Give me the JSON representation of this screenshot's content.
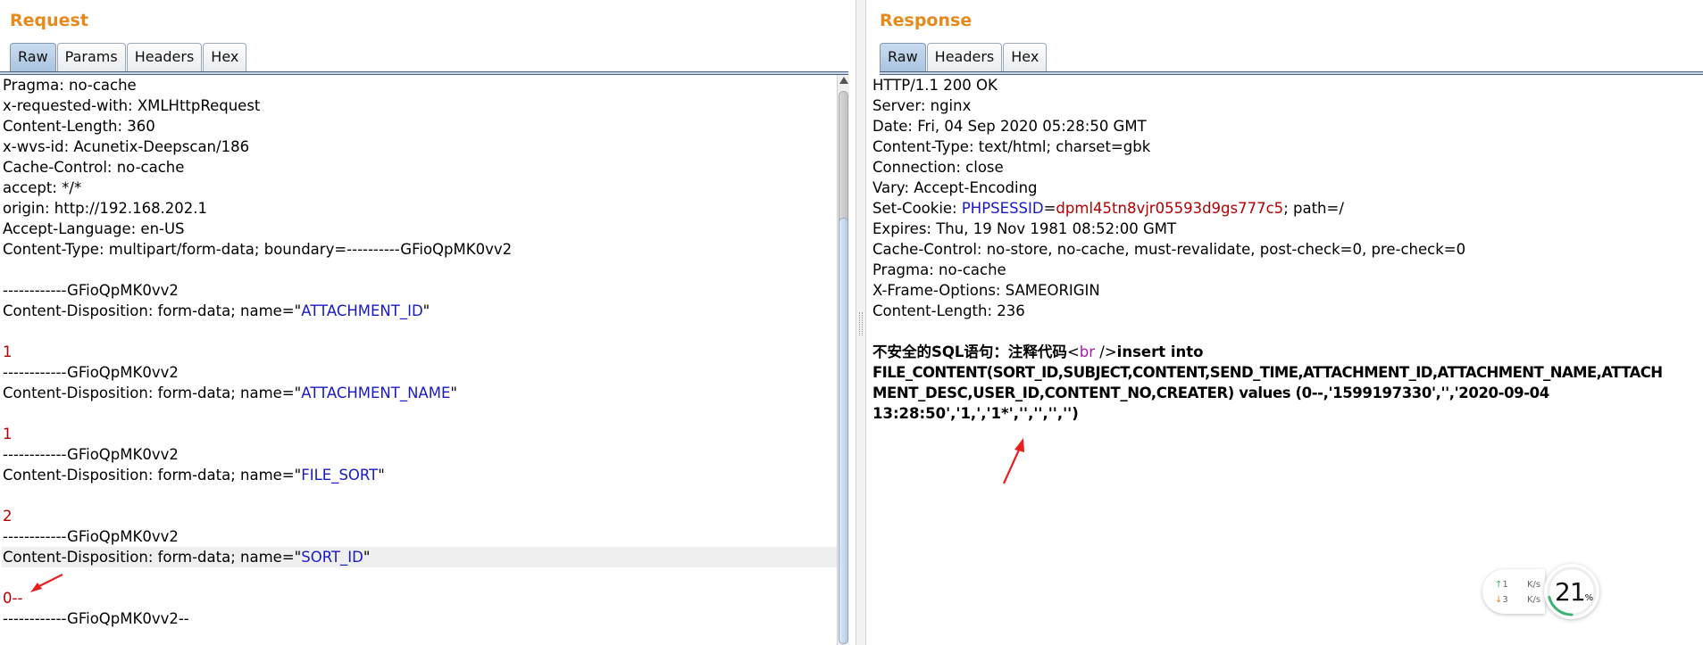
{
  "request": {
    "title": "Request",
    "tabs": [
      "Raw",
      "Params",
      "Headers",
      "Hex"
    ],
    "active_tab": "Raw",
    "lines": [
      "Pragma: no-cache",
      "x-requested-with: XMLHttpRequest",
      "Content-Length: 360",
      "x-wvs-id: Acunetix-Deepscan/186",
      "Cache-Control: no-cache",
      "accept: */*",
      "origin: http://192.168.202.1",
      "Accept-Language: en-US",
      "Content-Type: multipart/form-data; boundary=----------GFioQpMK0vv2",
      "",
      "------------GFioQpMK0vv2",
      "Content-Disposition: form-data; name=\"ATTACHMENT_ID\"",
      "",
      "1",
      "------------GFioQpMK0vv2",
      "Content-Disposition: form-data; name=\"ATTACHMENT_NAME\"",
      "",
      "1",
      "------------GFioQpMK0vv2",
      "Content-Disposition: form-data; name=\"FILE_SORT\"",
      "",
      "2",
      "------------GFioQpMK0vv2",
      "Content-Disposition: form-data; name=\"SORT_ID\"",
      "",
      "0--",
      "------------GFioQpMK0vv2--"
    ],
    "cd_prefix": "Content-Disposition: form-data; name=",
    "field_names": [
      "ATTACHMENT_ID",
      "ATTACHMENT_NAME",
      "FILE_SORT",
      "SORT_ID"
    ],
    "values": [
      "1",
      "1",
      "2",
      "0--"
    ]
  },
  "response": {
    "title": "Response",
    "tabs": [
      "Raw",
      "Headers",
      "Hex"
    ],
    "active_tab": "Raw",
    "headers": [
      "HTTP/1.1 200 OK",
      "Server: nginx",
      "Date: Fri, 04 Sep 2020 05:28:50 GMT",
      "Content-Type: text/html; charset=gbk",
      "Connection: close",
      "Vary: Accept-Encoding"
    ],
    "set_cookie": {
      "prefix": "Set-Cookie: ",
      "name": "PHPSESSID",
      "eq": "=",
      "value": "dpml45tn8vjr05593d9gs777c5",
      "suffix": "; path=/"
    },
    "headers2": [
      "Expires: Thu, 19 Nov 1981 08:52:00 GMT",
      "Cache-Control: no-store, no-cache, must-revalidate, post-check=0, pre-check=0",
      "Pragma: no-cache",
      "X-Frame-Options: SAMEORIGIN",
      "Content-Length: 236"
    ],
    "body": {
      "lead": "不安全的SQL语句：注释代码",
      "tag_open": "<",
      "tag_name": "br",
      "tag_close": " />",
      "after_tag": "insert into",
      "line2": "FILE_CONTENT(SORT_ID,SUBJECT,CONTENT,SEND_TIME,ATTACHMENT_ID,ATTACHMENT_NAME,ATTACH",
      "line3": "MENT_DESC,USER_ID,CONTENT_NO,CREATER) values (0--,'1599197330','','2020-09-04",
      "line4": "13:28:50','1,','1*','','','','')"
    }
  },
  "net_widget": {
    "up_value": "1",
    "down_value": "3",
    "unit": "K/s",
    "up_arrow": "↑",
    "down_arrow": "↓"
  },
  "cpu_widget": {
    "value": "21",
    "unit": "%",
    "fraction": 0.21
  }
}
